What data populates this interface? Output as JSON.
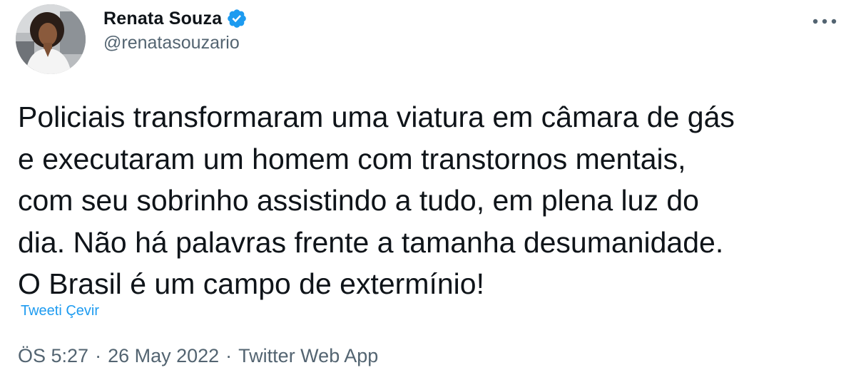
{
  "author": {
    "display_name": "Renata Souza",
    "handle": "@renatasouzario",
    "verified": true
  },
  "tweet": {
    "lines": [
      "Policiais transformaram uma viatura em câmara de gás",
      "e executaram um homem com transtornos mentais,",
      "com seu sobrinho assistindo a tudo, em plena luz do",
      "dia. Não há palavras frente a tamanha desumanidade.",
      "O Brasil é um campo de extermínio!"
    ],
    "translate_label": "Tweeti Çevir"
  },
  "meta": {
    "time": "ÖS 5:27",
    "separator": "·",
    "date": "26 May 2022",
    "source": "Twitter Web App"
  },
  "icons": {
    "verified": "verified-badge-icon",
    "more": "more-options-icon"
  },
  "colors": {
    "link": "#1d9bf0",
    "secondary_text": "#536471",
    "primary_text": "#0f1419",
    "verified": "#1d9bf0"
  }
}
